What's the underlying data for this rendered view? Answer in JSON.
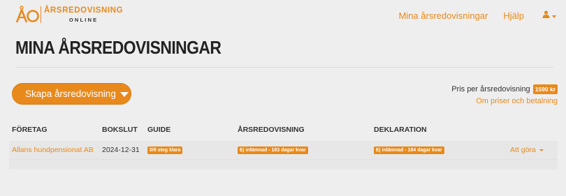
{
  "logo": {
    "title": "ÅRSREDOVISNING",
    "subtitle": "ONLINE"
  },
  "nav": {
    "main_link": "Mina årsredovisningar",
    "help_link": "Hjälp",
    "user_icon": "user-icon"
  },
  "page": {
    "title": "MINA ÅRSREDOVISNINGAR"
  },
  "actions": {
    "create_button": "Skapa årsredovisning"
  },
  "pricing": {
    "label": "Pris per årsredovisning",
    "price": "1590 kr",
    "link": "Om priser och betalning"
  },
  "table": {
    "headers": [
      "FÖRETAG",
      "BOKSLUT",
      "GUIDE",
      "ÅRSREDOVISNING",
      "DEKLARATION"
    ],
    "rows": [
      {
        "company": "Allans hundpensionat AB",
        "closing_date": "2024-12-31",
        "guide": "0/9 steg klara",
        "annual_report": "Ej inlämnad - 183 dagar kvar",
        "declaration": "Ej inlämnad - 184 dagar kvar",
        "todo": "Att göra"
      }
    ]
  },
  "colors": {
    "accent": "#e8891b",
    "background": "#eeeeee"
  }
}
